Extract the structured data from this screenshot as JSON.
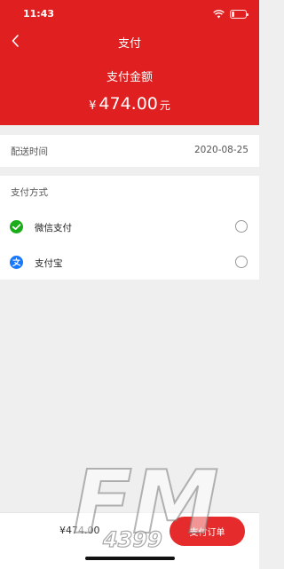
{
  "status_bar": {
    "time": "11:43"
  },
  "nav": {
    "title": "支付",
    "back_icon": "chevron-left-icon"
  },
  "amount": {
    "label": "支付金额",
    "currency": "¥",
    "value": "474.00",
    "unit": "元"
  },
  "delivery": {
    "label": "配送时间",
    "date": "2020-08-25"
  },
  "payment": {
    "title": "支付方式",
    "options": [
      {
        "label": "微信支付",
        "icon": "wechat-pay-icon",
        "selected": false
      },
      {
        "label": "支付宝",
        "icon": "alipay-icon",
        "selected": false
      }
    ]
  },
  "footer": {
    "total": "¥474.00",
    "submit_label": "支付订单"
  },
  "watermark": {
    "text": "FM",
    "subtext": "4399"
  },
  "colors": {
    "brand_red": "#e02020",
    "button_red": "#e52b2b",
    "wechat_green": "#1aad19",
    "alipay_blue": "#1677ff"
  }
}
